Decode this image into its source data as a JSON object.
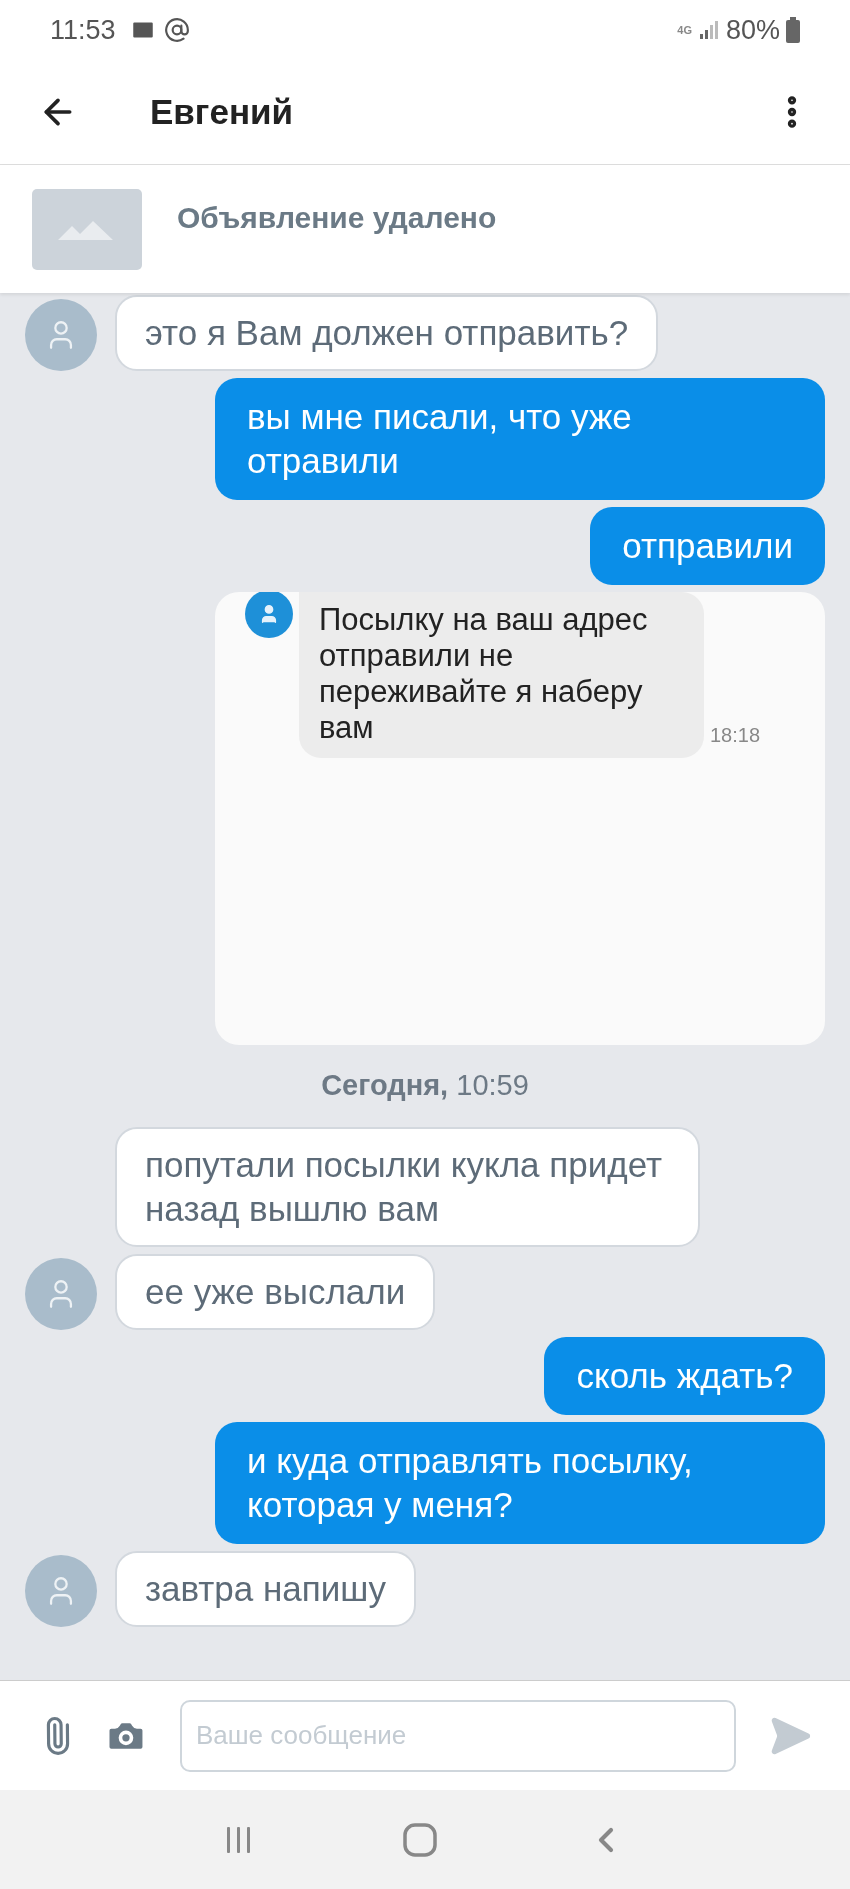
{
  "status_bar": {
    "time": "11:53",
    "network": "4G",
    "battery": "80%"
  },
  "header": {
    "title": "Евгений"
  },
  "listing": {
    "title": "Объявление удалено"
  },
  "messages": [
    {
      "kind": "incoming",
      "text": "это я Вам должен отправить?",
      "avatar": true
    },
    {
      "kind": "outgoing",
      "text": "вы мне писали, что уже отравили"
    },
    {
      "kind": "outgoing",
      "text": "отправили"
    },
    {
      "kind": "screenshot",
      "text": "Посылку на ваш адрес отправили не переживайте я наберу вам",
      "time": "18:18"
    },
    {
      "kind": "date",
      "day": "Сегодня,",
      "time": "10:59"
    },
    {
      "kind": "incoming",
      "text": "попутали посылки кукла придет назад вышлю вам",
      "avatar": false
    },
    {
      "kind": "incoming",
      "text": "ее уже выслали",
      "avatar": true
    },
    {
      "kind": "outgoing",
      "text": "сколь ждать?"
    },
    {
      "kind": "outgoing",
      "text": "и куда отправлять посылку, которая у меня?"
    },
    {
      "kind": "incoming",
      "text": "завтра напишу",
      "avatar": true
    }
  ],
  "composer": {
    "placeholder": "Ваше сообщение"
  }
}
